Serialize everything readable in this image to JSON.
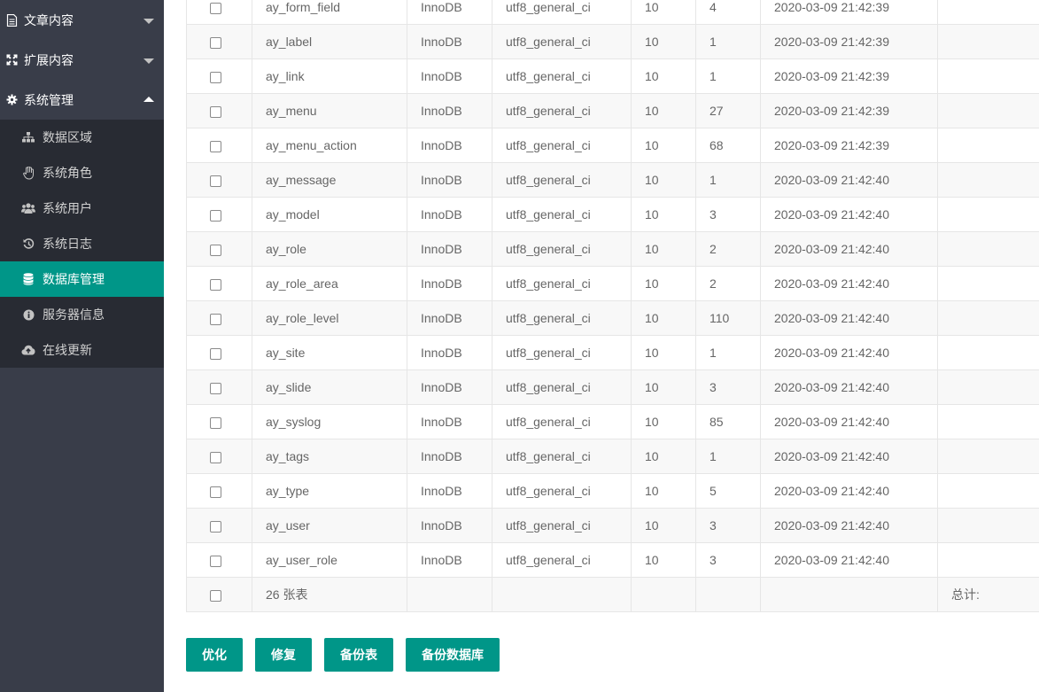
{
  "sidebar": {
    "groups": [
      {
        "label": "文章内容",
        "icon": "document-icon",
        "expanded": false
      },
      {
        "label": "扩展内容",
        "icon": "expand-icon",
        "expanded": false
      },
      {
        "label": "系统管理",
        "icon": "gear-icon",
        "expanded": true
      }
    ],
    "items": [
      {
        "label": "数据区域",
        "icon": "sitemap-icon"
      },
      {
        "label": "系统角色",
        "icon": "hand-icon"
      },
      {
        "label": "系统用户",
        "icon": "users-icon"
      },
      {
        "label": "系统日志",
        "icon": "history-icon"
      },
      {
        "label": "数据库管理",
        "icon": "database-icon",
        "active": true
      },
      {
        "label": "服务器信息",
        "icon": "info-icon"
      },
      {
        "label": "在线更新",
        "icon": "cloud-upload-icon"
      }
    ]
  },
  "colors": {
    "accent": "#009688",
    "sidebar": "#393d49",
    "submenu": "#282b33"
  },
  "table": {
    "rows": [
      {
        "name": "ay_form_field",
        "engine": "InnoDB",
        "collation": "utf8_general_ci",
        "c1": "10",
        "rows": "4",
        "time": "2020-03-09 21:42:39"
      },
      {
        "name": "ay_label",
        "engine": "InnoDB",
        "collation": "utf8_general_ci",
        "c1": "10",
        "rows": "1",
        "time": "2020-03-09 21:42:39"
      },
      {
        "name": "ay_link",
        "engine": "InnoDB",
        "collation": "utf8_general_ci",
        "c1": "10",
        "rows": "1",
        "time": "2020-03-09 21:42:39"
      },
      {
        "name": "ay_menu",
        "engine": "InnoDB",
        "collation": "utf8_general_ci",
        "c1": "10",
        "rows": "27",
        "time": "2020-03-09 21:42:39"
      },
      {
        "name": "ay_menu_action",
        "engine": "InnoDB",
        "collation": "utf8_general_ci",
        "c1": "10",
        "rows": "68",
        "time": "2020-03-09 21:42:39"
      },
      {
        "name": "ay_message",
        "engine": "InnoDB",
        "collation": "utf8_general_ci",
        "c1": "10",
        "rows": "1",
        "time": "2020-03-09 21:42:40"
      },
      {
        "name": "ay_model",
        "engine": "InnoDB",
        "collation": "utf8_general_ci",
        "c1": "10",
        "rows": "3",
        "time": "2020-03-09 21:42:40"
      },
      {
        "name": "ay_role",
        "engine": "InnoDB",
        "collation": "utf8_general_ci",
        "c1": "10",
        "rows": "2",
        "time": "2020-03-09 21:42:40"
      },
      {
        "name": "ay_role_area",
        "engine": "InnoDB",
        "collation": "utf8_general_ci",
        "c1": "10",
        "rows": "2",
        "time": "2020-03-09 21:42:40"
      },
      {
        "name": "ay_role_level",
        "engine": "InnoDB",
        "collation": "utf8_general_ci",
        "c1": "10",
        "rows": "110",
        "time": "2020-03-09 21:42:40"
      },
      {
        "name": "ay_site",
        "engine": "InnoDB",
        "collation": "utf8_general_ci",
        "c1": "10",
        "rows": "1",
        "time": "2020-03-09 21:42:40"
      },
      {
        "name": "ay_slide",
        "engine": "InnoDB",
        "collation": "utf8_general_ci",
        "c1": "10",
        "rows": "3",
        "time": "2020-03-09 21:42:40"
      },
      {
        "name": "ay_syslog",
        "engine": "InnoDB",
        "collation": "utf8_general_ci",
        "c1": "10",
        "rows": "85",
        "time": "2020-03-09 21:42:40"
      },
      {
        "name": "ay_tags",
        "engine": "InnoDB",
        "collation": "utf8_general_ci",
        "c1": "10",
        "rows": "1",
        "time": "2020-03-09 21:42:40"
      },
      {
        "name": "ay_type",
        "engine": "InnoDB",
        "collation": "utf8_general_ci",
        "c1": "10",
        "rows": "5",
        "time": "2020-03-09 21:42:40"
      },
      {
        "name": "ay_user",
        "engine": "InnoDB",
        "collation": "utf8_general_ci",
        "c1": "10",
        "rows": "3",
        "time": "2020-03-09 21:42:40"
      },
      {
        "name": "ay_user_role",
        "engine": "InnoDB",
        "collation": "utf8_general_ci",
        "c1": "10",
        "rows": "3",
        "time": "2020-03-09 21:42:40"
      }
    ],
    "footer": {
      "count_label": "26 张表",
      "total_label": "总计:"
    }
  },
  "buttons": {
    "optimize": "优化",
    "repair": "修复",
    "backup_table": "备份表",
    "backup_db": "备份数据库"
  }
}
